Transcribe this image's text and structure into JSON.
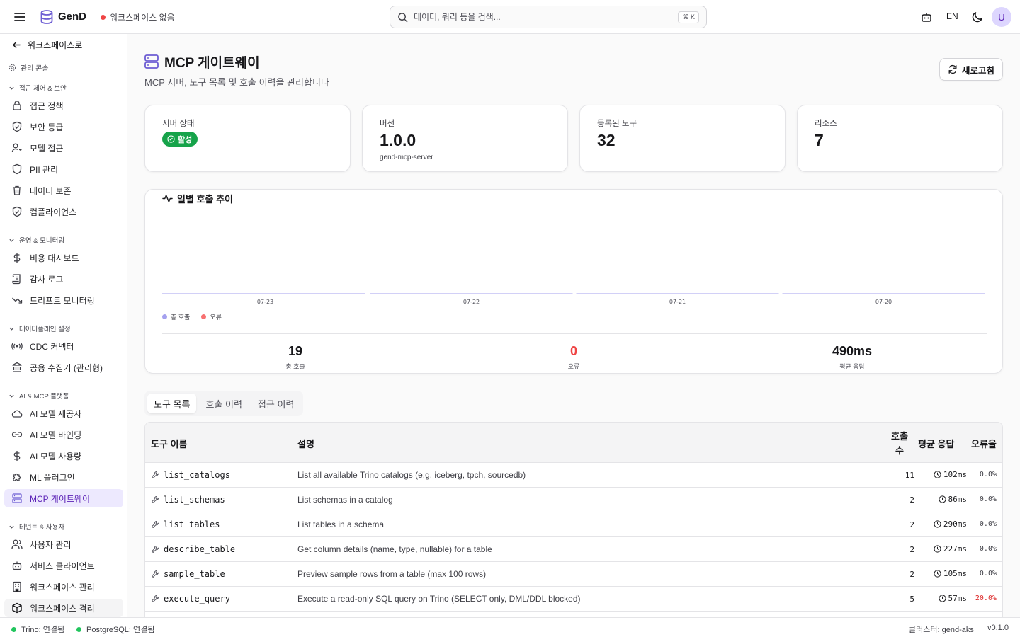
{
  "topbar": {
    "brand": "GenD",
    "workspace": "워크스페이스 없음",
    "search_placeholder": "데이터, 쿼리 등을 검색...",
    "shortcut": "⌘ K",
    "lang": "EN",
    "avatar": "U"
  },
  "sidebar": {
    "back": "워크스페이스로",
    "console": "관리 콘솔",
    "groups": [
      {
        "label": "접근 제어 & 보안",
        "items": [
          "접근 정책",
          "보안 등급",
          "모델 접근",
          "PII 관리",
          "데이터 보존",
          "컴플라이언스"
        ]
      },
      {
        "label": "운영 & 모니터링",
        "items": [
          "비용 대시보드",
          "감사 로그",
          "드리프트 모니터링"
        ]
      },
      {
        "label": "데이터플레인 설정",
        "items": [
          "CDC 커넥터",
          "공용 수집기 (관리형)"
        ]
      },
      {
        "label": "AI & MCP 플랫폼",
        "items": [
          "AI 모델 제공자",
          "AI 모델 바인딩",
          "AI 모델 사용량",
          "ML 플러그인",
          "MCP 게이트웨이"
        ]
      },
      {
        "label": "테넌트 & 사용자",
        "items": [
          "사용자 관리",
          "서비스 클라이언트",
          "워크스페이스 관리",
          "워크스페이스 격리"
        ]
      }
    ]
  },
  "page": {
    "title": "MCP 게이트웨이",
    "subtitle": "MCP 서버, 도구 목록 및 호출 이력을 관리합니다",
    "refresh": "새로고침"
  },
  "cards": {
    "status": {
      "label": "서버 상태",
      "badge": "활성"
    },
    "version": {
      "label": "버전",
      "value": "1.0.0",
      "sub": "gend-mcp-server"
    },
    "tools": {
      "label": "등록된 도구",
      "value": "32"
    },
    "resources": {
      "label": "리소스",
      "value": "7"
    }
  },
  "chart": {
    "title": "일별 호출 추이",
    "legend_total": "총 호출",
    "legend_error": "오류",
    "summary": {
      "total": {
        "value": "19",
        "label": "총 호출"
      },
      "errors": {
        "value": "0",
        "label": "오류"
      },
      "avg": {
        "value": "490ms",
        "label": "평균 응답"
      }
    }
  },
  "chart_data": {
    "type": "bar",
    "categories": [
      "07-23",
      "07-22",
      "07-21",
      "07-20"
    ],
    "series": [
      {
        "name": "총 호출",
        "values": [
          0,
          0,
          0,
          0
        ]
      },
      {
        "name": "오류",
        "values": [
          0,
          0,
          0,
          0
        ]
      }
    ],
    "title": "일별 호출 추이",
    "legend": "bottom-left",
    "grid": false,
    "colors": {
      "total": "#a5a1ef",
      "error": "#f87171"
    }
  },
  "tabs": [
    "도구 목록",
    "호출 이력",
    "접근 이력"
  ],
  "table": {
    "headers": {
      "name": "도구 이름",
      "desc": "설명",
      "calls_1": "호출",
      "calls_2": "수",
      "avg": "평균 응답",
      "err": "오류율"
    },
    "rows": [
      {
        "name": "list_catalogs",
        "desc": "List all available Trino catalogs (e.g. iceberg, tpch, sourcedb)",
        "calls": "11",
        "avg": "102ms",
        "err": "0.0%"
      },
      {
        "name": "list_schemas",
        "desc": "List schemas in a catalog",
        "calls": "2",
        "avg": "86ms",
        "err": "0.0%"
      },
      {
        "name": "list_tables",
        "desc": "List tables in a schema",
        "calls": "2",
        "avg": "290ms",
        "err": "0.0%"
      },
      {
        "name": "describe_table",
        "desc": "Get column details (name, type, nullable) for a table",
        "calls": "2",
        "avg": "227ms",
        "err": "0.0%"
      },
      {
        "name": "sample_table",
        "desc": "Preview sample rows from a table (max 100 rows)",
        "calls": "2",
        "avg": "105ms",
        "err": "0.0%"
      },
      {
        "name": "execute_query",
        "desc": "Execute a read-only SQL query on Trino (SELECT only, DML/DDL blocked)",
        "calls": "5",
        "avg": "57ms",
        "err": "20.0%"
      }
    ]
  },
  "statusbar": {
    "trino": "Trino: 연결됨",
    "postgres": "PostgreSQL: 연결됨",
    "cluster": "클러스터: gend-aks",
    "version": "v0.1.0"
  },
  "colors": {
    "accent": "#6d5dd3",
    "ok": "#16a34a",
    "error": "#ef4444"
  }
}
